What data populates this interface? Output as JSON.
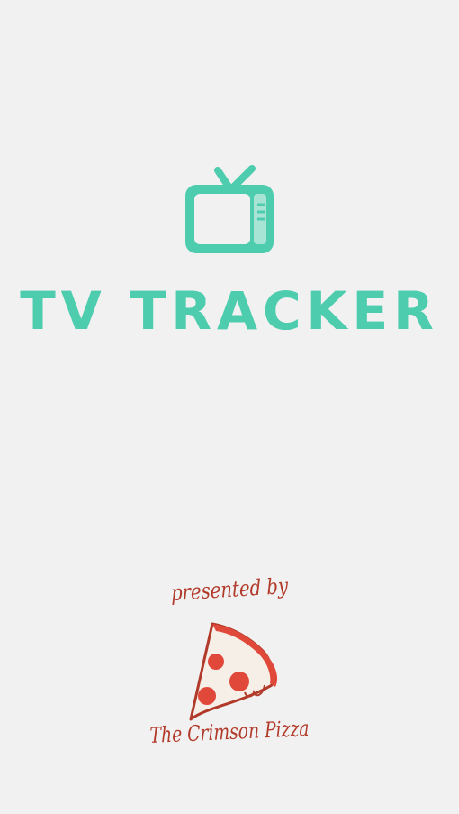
{
  "app": {
    "title": "TV TRACKER",
    "logo_icon": "tv-icon",
    "accent_color": "#4ecdae",
    "background_color": "#f1f1f1"
  },
  "credits": {
    "presented_by": "presented by",
    "brand_name": "The Crimson Pizza",
    "brand_icon": "pizza-slice-icon",
    "brand_color": "#b23a2a"
  }
}
